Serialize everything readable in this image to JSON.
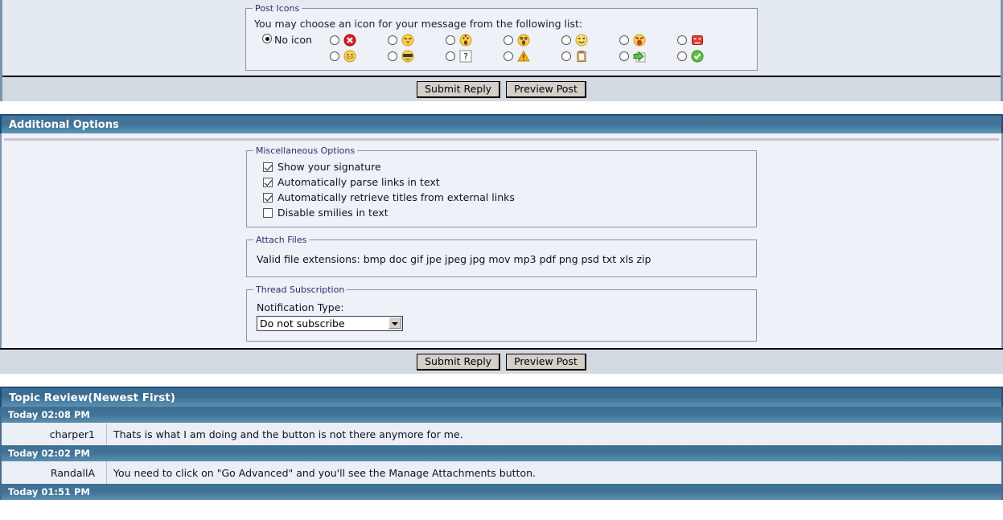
{
  "post_icons": {
    "legend": "Post Icons",
    "hint": "You may choose an icon for your message from the following list:",
    "no_icon_label": "No icon",
    "columns": [
      {
        "top": "red-x-circle-icon",
        "bottom": "smiley-grin-icon"
      },
      {
        "top": "smiley-tongue-icon",
        "bottom": "smiley-cool-icon"
      },
      {
        "top": "smiley-exclaim-icon",
        "bottom": "question-mark-icon"
      },
      {
        "top": "smiley-surprised-icon",
        "bottom": "warning-triangle-icon"
      },
      {
        "top": "smiley-happy-icon",
        "bottom": "clipboard-icon"
      },
      {
        "top": "smiley-angry-red-icon",
        "bottom": "green-arrow-icon"
      },
      {
        "top": "red-angry-square-icon",
        "bottom": "green-check-circle-icon"
      }
    ]
  },
  "buttons": {
    "submit_reply": "Submit Reply",
    "preview_post": "Preview Post"
  },
  "additional_options": {
    "title": "Additional Options",
    "misc": {
      "legend": "Miscellaneous Options",
      "items": [
        {
          "label": "Show your signature",
          "checked": true
        },
        {
          "label": "Automatically parse links in text",
          "checked": true
        },
        {
          "label": "Automatically retrieve titles from external links",
          "checked": true
        },
        {
          "label": "Disable smilies in text",
          "checked": false
        }
      ]
    },
    "attach": {
      "legend": "Attach Files",
      "text": "Valid file extensions: bmp doc gif jpe jpeg jpg mov mp3 pdf png psd txt xls zip"
    },
    "subscription": {
      "legend": "Thread Subscription",
      "label": "Notification Type:",
      "selected": "Do not subscribe",
      "options": [
        "Do not subscribe"
      ]
    }
  },
  "topic_review": {
    "title": "Topic Review",
    "subtitle": "(Newest First)",
    "entries": [
      {
        "date": "Today 02:08 PM",
        "user": "charper1",
        "message": "Thats is what I am doing and the button is not there anymore for me."
      },
      {
        "date": "Today 02:02 PM",
        "user": "RandallA",
        "message": "You need to click on \"Go Advanced\" and you'll see the Manage Attachments button."
      },
      {
        "date": "Today 01:51 PM",
        "user": "",
        "message": ""
      }
    ]
  },
  "colors": {
    "header_blue": "#3f7096",
    "panel_bg": "#eef1f8",
    "button_face": "#d4d0c8",
    "legend_text": "#2c2c6e"
  }
}
